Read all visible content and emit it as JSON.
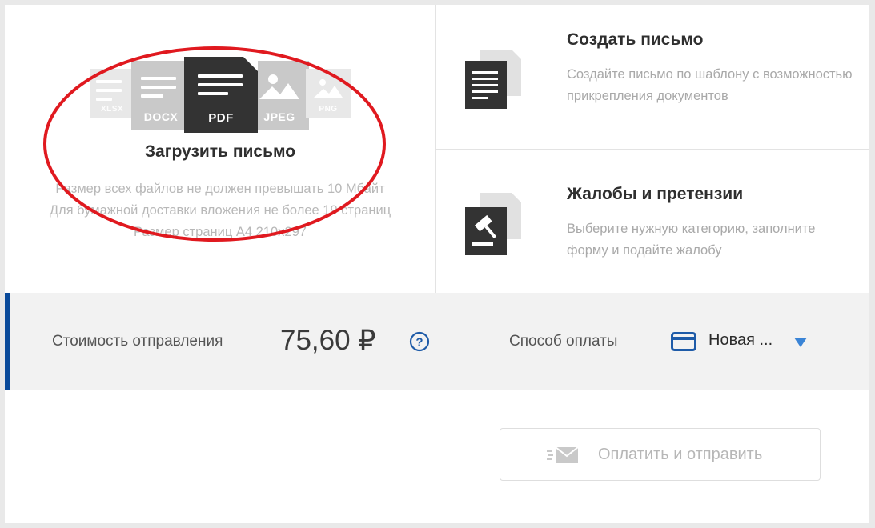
{
  "upload": {
    "file_types": [
      "XLSX",
      "DOCX",
      "PDF",
      "JPEG",
      "PNG"
    ],
    "title": "Загрузить письмо",
    "notes": [
      "Размер всех файлов не должен превышать 10 Мбайт",
      "Для бумажной доставки вложения не более 19 страниц",
      "Размер страниц A4 210x297"
    ]
  },
  "create_letter": {
    "title": "Создать письмо",
    "description": "Создайте письмо по шаблону с возможностью прикрепления документов",
    "icon": "document-icon"
  },
  "complaints": {
    "title": "Жалобы и претензии",
    "description": "Выберите нужную категорию, заполните форму и подайте жалобу",
    "icon": "gavel-icon"
  },
  "cost": {
    "label": "Стоимость отправления",
    "value": "75,60 ₽",
    "help_icon": "help-icon"
  },
  "payment": {
    "label": "Способ оплаты",
    "selected": "Новая ...",
    "icon": "credit-card-icon"
  },
  "submit": {
    "label": "Оплатить и отправить",
    "icon": "send-envelope-icon"
  },
  "colors": {
    "accent": "#0a4a9a",
    "icon_blue": "#1e5ba8",
    "caret_blue": "#3a84d6",
    "annotation_red": "#e0191f",
    "dark_icon": "#333333"
  }
}
